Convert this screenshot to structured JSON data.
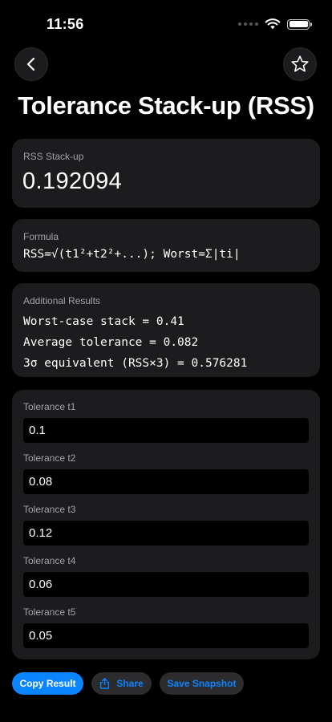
{
  "status_bar": {
    "time": "11:56"
  },
  "header": {
    "title": "Tolerance Stack-up (RSS)"
  },
  "result": {
    "label": "RSS Stack-up",
    "value": "0.192094"
  },
  "formula": {
    "label": "Formula",
    "text": "RSS=√(t1²+t2²+...); Worst=Σ|ti|"
  },
  "additional": {
    "label": "Additional Results",
    "lines": [
      "Worst-case stack = 0.41",
      "Average tolerance = 0.082",
      "3σ equivalent (RSS×3) = 0.576281"
    ]
  },
  "inputs": [
    {
      "label": "Tolerance t1",
      "value": "0.1"
    },
    {
      "label": "Tolerance t2",
      "value": "0.08"
    },
    {
      "label": "Tolerance t3",
      "value": "0.12"
    },
    {
      "label": "Tolerance t4",
      "value": "0.06"
    },
    {
      "label": "Tolerance t5",
      "value": "0.05"
    }
  ],
  "actions": {
    "copy": "Copy Result",
    "share": "Share",
    "snapshot": "Save Snapshot"
  },
  "icons": {
    "back": "chevron-left-icon",
    "favorite": "star-icon",
    "share": "share-icon"
  },
  "colors": {
    "accent": "#0a84ff",
    "card": "#1c1c1e",
    "background": "#000000"
  }
}
